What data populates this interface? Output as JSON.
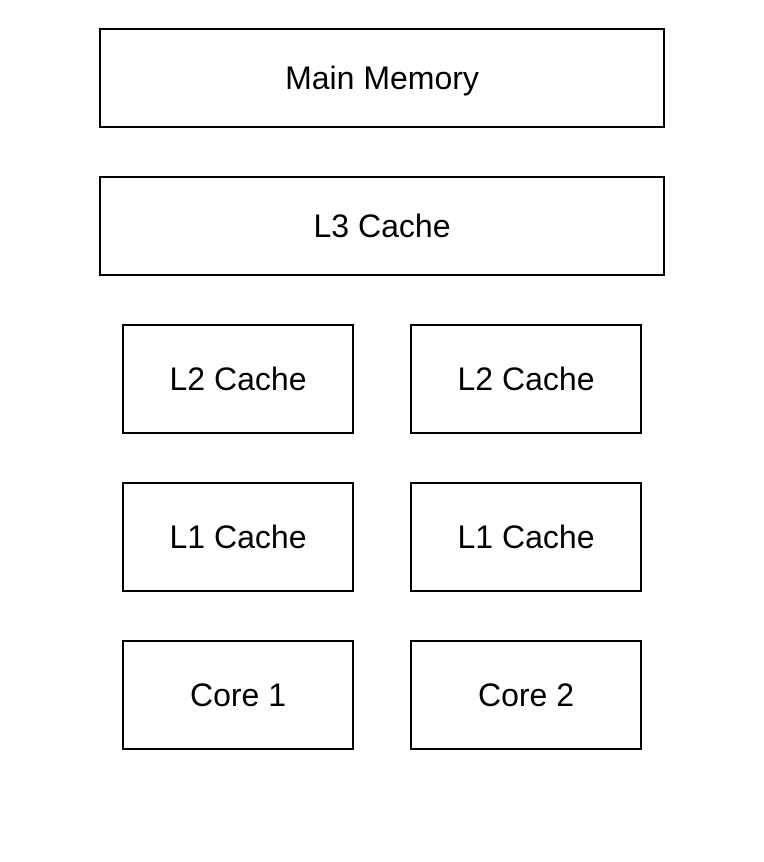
{
  "diagram": {
    "main_memory": "Main Memory",
    "l3_cache": "L3 Cache",
    "left": {
      "l2": "L2 Cache",
      "l1": "L1 Cache",
      "core": "Core 1"
    },
    "right": {
      "l2": "L2 Cache",
      "l1": "L1 Cache",
      "core": "Core 2"
    }
  }
}
